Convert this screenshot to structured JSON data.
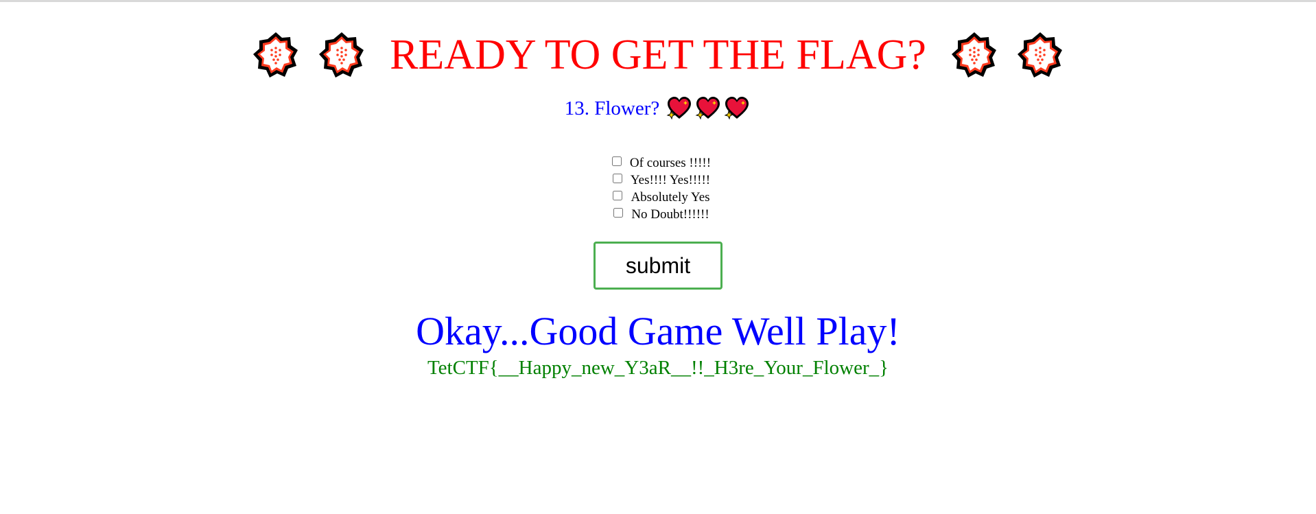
{
  "header": {
    "title": "READY TO GET THE FLAG?",
    "decoration_icon": "flower-icon",
    "title_color": "#ff0000"
  },
  "question": {
    "text": "13. Flower?",
    "icon": "sparkling-heart-icon",
    "color": "#0000ff"
  },
  "options": [
    {
      "label": "Of courses !!!!!",
      "checked": false
    },
    {
      "label": "Yes!!!! Yes!!!!!",
      "checked": false
    },
    {
      "label": "Absolutely Yes",
      "checked": false
    },
    {
      "label": "No Doubt!!!!!!",
      "checked": false
    }
  ],
  "form": {
    "submit_label": "submit",
    "button_border_color": "#4caf50"
  },
  "result": {
    "heading": "Okay...Good Game Well Play!",
    "flag": "TetCTF{__Happy_new_Y3aR__!!_H3re_Your_Flower_}",
    "heading_color": "#0000ff",
    "flag_color": "#008000"
  }
}
